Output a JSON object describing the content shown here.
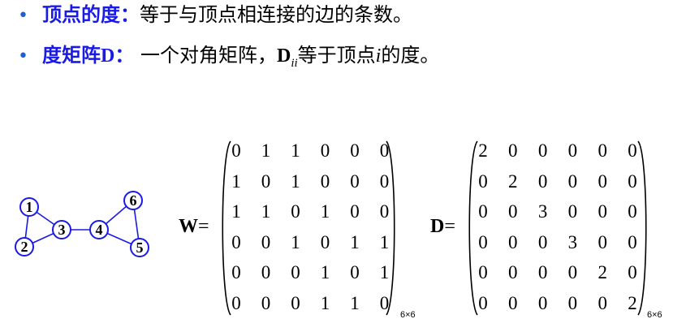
{
  "bullets": [
    {
      "marker": "•",
      "term": "顶点的度：",
      "text": "等于与顶点相连接的边的条数。"
    },
    {
      "marker": "•",
      "term": "度矩阵",
      "term_symbol": "D",
      "term_colon": "：",
      "text_a": "一个对角矩阵，",
      "symbol": "D",
      "subscript": "ii",
      "text_b": "等于顶点",
      "var": "i",
      "text_c": "的度。"
    }
  ],
  "graph": {
    "node_color": "#1a1ae6",
    "nodes": [
      {
        "id": "1",
        "label": "1"
      },
      {
        "id": "2",
        "label": "2"
      },
      {
        "id": "3",
        "label": "3"
      },
      {
        "id": "4",
        "label": "4"
      },
      {
        "id": "5",
        "label": "5"
      },
      {
        "id": "6",
        "label": "6"
      }
    ],
    "edges": [
      [
        "1",
        "2"
      ],
      [
        "1",
        "3"
      ],
      [
        "2",
        "3"
      ],
      [
        "3",
        "4"
      ],
      [
        "4",
        "5"
      ],
      [
        "4",
        "6"
      ],
      [
        "5",
        "6"
      ]
    ]
  },
  "matrix_W": {
    "name": "W",
    "eq": "=",
    "size_label": "6×6",
    "rows": [
      [
        "0",
        "1",
        "1",
        "0",
        "0",
        "0"
      ],
      [
        "1",
        "0",
        "1",
        "0",
        "0",
        "0"
      ],
      [
        "1",
        "1",
        "0",
        "1",
        "0",
        "0"
      ],
      [
        "0",
        "0",
        "1",
        "0",
        "1",
        "1"
      ],
      [
        "0",
        "0",
        "0",
        "1",
        "0",
        "1"
      ],
      [
        "0",
        "0",
        "0",
        "1",
        "1",
        "0"
      ]
    ]
  },
  "matrix_D": {
    "name": "D",
    "eq": "=",
    "size_label": "6×6",
    "rows": [
      [
        "2",
        "0",
        "0",
        "0",
        "0",
        "0"
      ],
      [
        "0",
        "2",
        "0",
        "0",
        "0",
        "0"
      ],
      [
        "0",
        "0",
        "3",
        "0",
        "0",
        "0"
      ],
      [
        "0",
        "0",
        "0",
        "3",
        "0",
        "0"
      ],
      [
        "0",
        "0",
        "0",
        "0",
        "2",
        "0"
      ],
      [
        "0",
        "0",
        "0",
        "0",
        "0",
        "2"
      ]
    ]
  }
}
